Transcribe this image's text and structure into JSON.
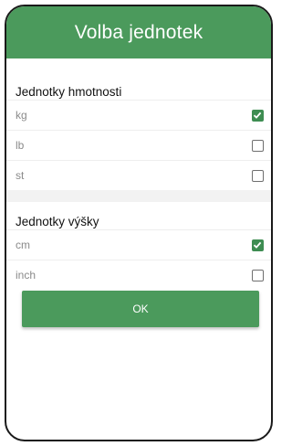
{
  "dialog": {
    "title": "Volba jednotek",
    "ok_label": "OK"
  },
  "weight": {
    "title": "Jednotky hmotnosti",
    "items": [
      {
        "label": "kg",
        "checked": true
      },
      {
        "label": "lb",
        "checked": false
      },
      {
        "label": "st",
        "checked": false
      }
    ]
  },
  "height": {
    "title": "Jednotky výšky",
    "items": [
      {
        "label": "cm",
        "checked": true
      },
      {
        "label": "inch",
        "checked": false
      }
    ]
  },
  "colors": {
    "accent": "#4b9a5c",
    "checkbox_on": "#3e8d52"
  }
}
